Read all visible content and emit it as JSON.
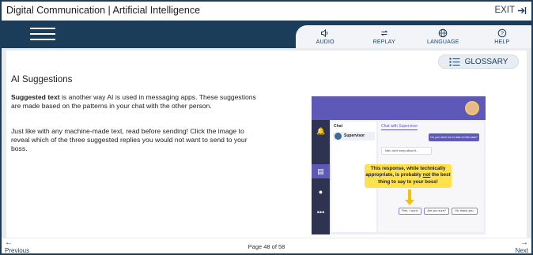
{
  "app": {
    "title": "Digital Communication | Artificial Intelligence",
    "exit_label": "EXIT"
  },
  "nav": {
    "items": [
      {
        "label": "AUDIO",
        "icon": "speaker-icon"
      },
      {
        "label": "REPLAY",
        "icon": "replay-icon"
      },
      {
        "label": "LANGUAGE",
        "icon": "globe-icon"
      },
      {
        "label": "HELP",
        "icon": "help-icon"
      }
    ]
  },
  "content": {
    "glossary_label": "GLOSSARY",
    "heading": "AI Suggestions",
    "p1_bold": "Suggested text",
    "p1_rest": " is another way AI is used in messaging apps. These suggestions are made based on the patterns in your chat with the other person.",
    "p2": "Just like with any machine-made text, read before sending! Click the image to reveal which of the three suggested replies you would not want to send to your boss."
  },
  "image": {
    "chat_header": "Chat",
    "contact_name": "Supervisor",
    "chat_title": "Chat with Supervisor",
    "msg_sent": "Do you need me to take on this task?",
    "msg_received": "Nah, don't worry about it...",
    "callout_pre": "This response, while technically appropriate, is probably ",
    "callout_em": "not",
    "callout_post": " the best thing to say to your boss!",
    "suggestions": [
      "Fine, I won't.",
      "Are you sure?",
      "Ok, thank you."
    ]
  },
  "footer": {
    "prev_label": "Previous",
    "next_label": "Next",
    "page_text": "Page 48 of 58"
  },
  "colors": {
    "navy": "#1c3d5a",
    "purple": "#5e58b8",
    "highlight": "#ffe24d"
  }
}
